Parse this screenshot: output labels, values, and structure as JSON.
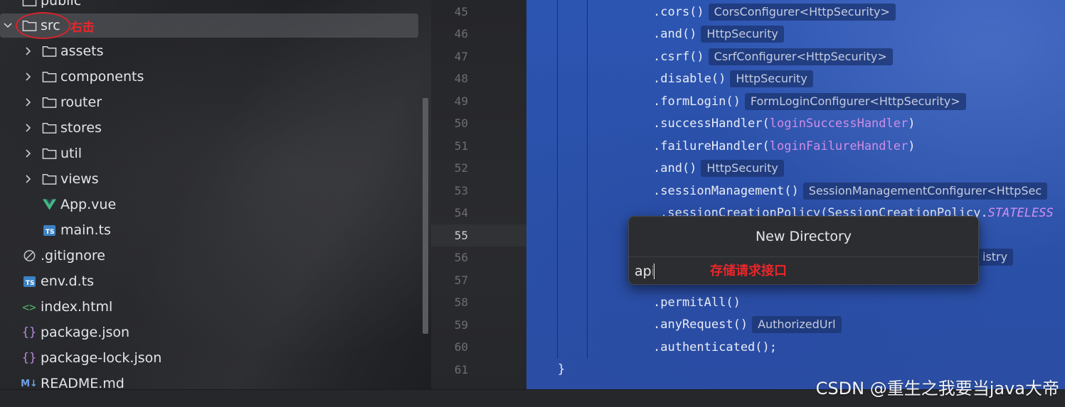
{
  "tree": {
    "items": [
      {
        "label": "public",
        "type": "folder",
        "expanded": false
      },
      {
        "label": "src",
        "type": "folder",
        "expanded": true,
        "selected": true,
        "annotation": "右击"
      },
      {
        "label": "assets",
        "type": "folder",
        "expanded": false
      },
      {
        "label": "components",
        "type": "folder",
        "expanded": false
      },
      {
        "label": "router",
        "type": "folder",
        "expanded": false
      },
      {
        "label": "stores",
        "type": "folder",
        "expanded": false
      },
      {
        "label": "util",
        "type": "folder",
        "expanded": false
      },
      {
        "label": "views",
        "type": "folder",
        "expanded": false
      },
      {
        "label": "App.vue",
        "type": "vue-file"
      },
      {
        "label": "main.ts",
        "type": "ts-file",
        "badge": "TS"
      },
      {
        "label": ".gitignore",
        "type": "ignore-file"
      },
      {
        "label": "env.d.ts",
        "type": "ts-file",
        "badge": "TS"
      },
      {
        "label": "index.html",
        "type": "html-file"
      },
      {
        "label": "package.json",
        "type": "json-file"
      },
      {
        "label": "package-lock.json",
        "type": "json-file"
      },
      {
        "label": "README.md",
        "type": "md-file",
        "badge": "M↓"
      }
    ]
  },
  "gutter": {
    "lines": [
      "45",
      "46",
      "47",
      "48",
      "49",
      "50",
      "51",
      "52",
      "53",
      "54",
      "55",
      "56",
      "57",
      "58",
      "59",
      "60",
      "61"
    ],
    "current_line": "55"
  },
  "code": {
    "lines": [
      {
        "text": ".cors()",
        "hint": "CorsConfigurer<HttpSecurity>"
      },
      {
        "text": ".and()",
        "hint": "HttpSecurity"
      },
      {
        "text": ".csrf()",
        "hint": "CsrfConfigurer<HttpSecurity>"
      },
      {
        "text": ".disable()",
        "hint": "HttpSecurity"
      },
      {
        "text": ".formLogin()",
        "hint": "FormLoginConfigurer<HttpSecurity>"
      },
      {
        "pre": ".successHandler(",
        "arg": "loginSuccessHandler",
        "post": ")"
      },
      {
        "pre": ".failureHandler(",
        "arg": "loginFailureHandler",
        "post": ")"
      },
      {
        "text": ".and()",
        "hint": "HttpSecurity"
      },
      {
        "text": ".sessionManagement()",
        "hint": "SessionManagementConfigurer<HttpSec"
      },
      {
        "pre": ".sessionCreationPolicy(SessionCreationPolicy.",
        "arg": "STATELESS",
        "post": ""
      },
      {
        "hint_partial": "istry"
      },
      {
        "text": ".permitAll()"
      },
      {
        "text": ".anyRequest()",
        "hint": "AuthorizedUrl"
      },
      {
        "text": ".authenticated();"
      },
      {
        "text": "}"
      }
    ]
  },
  "popup": {
    "title": "New Directory",
    "input_value": "api",
    "annotation": "存储请求接口"
  },
  "watermark": "CSDN @重生之我要当java大帝",
  "colors": {
    "editor_bg": "#2c55b2",
    "annotation_red": "#e8262b",
    "param_purple": "#ce8de6"
  }
}
